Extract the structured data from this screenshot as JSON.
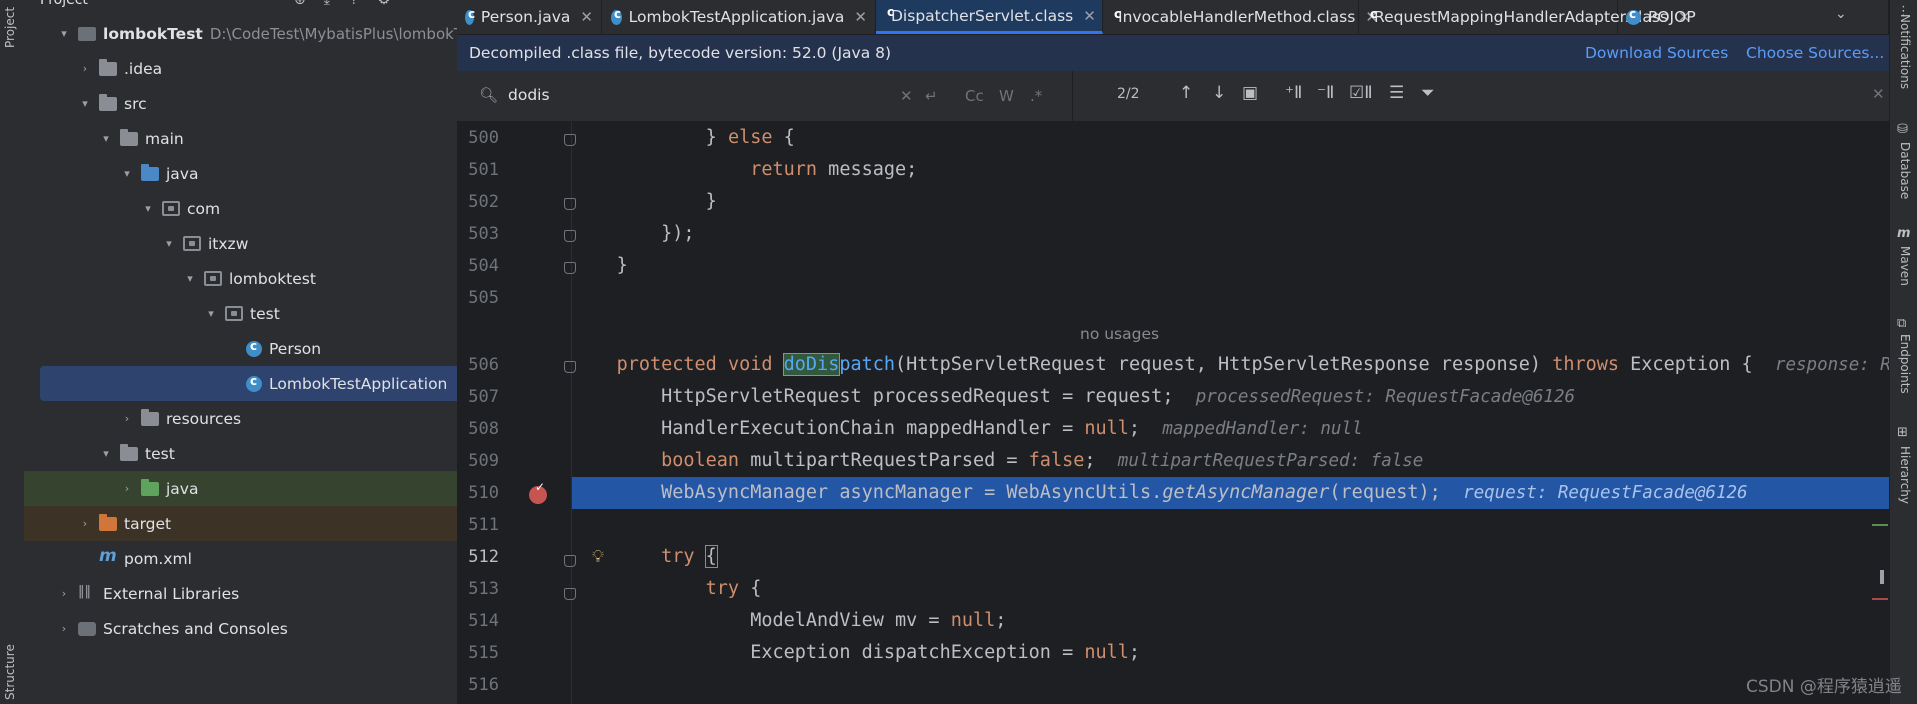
{
  "left_toolbar": {
    "project_label": "Project",
    "structure_label": "Structure"
  },
  "project_panel": {
    "title": "Project",
    "tree": [
      {
        "label": "lombokTest",
        "path": "D:\\CodeTest\\MybatisPlus\\lombokTest",
        "icon": "module-folder-icon",
        "expanded": true
      },
      {
        "label": ".idea",
        "icon": "folder-icon"
      },
      {
        "label": "src",
        "icon": "folder-icon"
      },
      {
        "label": "main",
        "icon": "folder-icon"
      },
      {
        "label": "java",
        "icon": "source-folder-icon"
      },
      {
        "label": "com",
        "icon": "package-icon"
      },
      {
        "label": "itxzw",
        "icon": "package-icon"
      },
      {
        "label": "lomboktest",
        "icon": "package-icon"
      },
      {
        "label": "test",
        "icon": "package-icon"
      },
      {
        "label": "Person",
        "icon": "class-icon"
      },
      {
        "label": "LombokTestApplication",
        "icon": "spring-class-icon"
      },
      {
        "label": "resources",
        "icon": "resources-folder-icon"
      },
      {
        "label": "test",
        "icon": "folder-icon"
      },
      {
        "label": "java",
        "icon": "test-source-folder-icon"
      },
      {
        "label": "target",
        "icon": "excluded-folder-icon"
      },
      {
        "label": "pom.xml",
        "icon": "maven-icon"
      },
      {
        "label": "External Libraries",
        "icon": "library-icon"
      },
      {
        "label": "Scratches and Consoles",
        "icon": "scratch-icon"
      }
    ]
  },
  "tabs": [
    {
      "label": "Person.java"
    },
    {
      "label": "LombokTestApplication.java"
    },
    {
      "label": "DispatcherServlet.class",
      "active": true
    },
    {
      "label": "InvocableHandlerMethod.class"
    },
    {
      "label": "RequestMappingHandlerAdapter.class"
    },
    {
      "label": "POJOP"
    }
  ],
  "banner": {
    "text": "Decompiled .class file, bytecode version: 52.0 (Java 8)",
    "download": "Download Sources",
    "choose": "Choose Sources..."
  },
  "search": {
    "value": "dodis",
    "count": "2/2",
    "case_label": "Cc",
    "word_label": "W",
    "regex_label": ".*"
  },
  "editor": {
    "no_usages": "no usages",
    "line_numbers": [
      "500",
      "501",
      "502",
      "503",
      "504",
      "505",
      "506",
      "507",
      "508",
      "509",
      "510",
      "511",
      "512",
      "513",
      "514",
      "515",
      "516"
    ],
    "lines": {
      "l500a": "} ",
      "l500b": "else",
      "l500c": " {",
      "l501a": "return",
      "l501b": " message;",
      "l502": "}",
      "l503": "});",
      "l504": "}",
      "l506kw1": "protected void ",
      "l506fn": "doDis",
      "l506fn2": "patch",
      "l506rest": "(HttpServletRequest request, HttpServletResponse response) ",
      "l506kw2": "throws",
      "l506end": " Exception {",
      "l506hint": "response: R",
      "l507": "HttpServletRequest processedRequest = request;",
      "l507hint": "processedRequest: RequestFacade@6126",
      "l508a": "HandlerExecutionChain mappedHandler = ",
      "l508kw": "null",
      "l508b": ";",
      "l508hint": "mappedHandler: null",
      "l509kw": "boolean",
      "l509a": " multipartRequestParsed = ",
      "l509kw2": "false",
      "l509b": ";",
      "l509hint": "multipartRequestParsed: false",
      "l510a": "WebAsyncManager asyncManager = WebAsyncUtils.",
      "l510fn": "getAsyncManager",
      "l510b": "(request);",
      "l510hint": "request: RequestFacade@6126",
      "l512kw": "try",
      "l512b": "{",
      "l513kw": "try",
      "l513b": " {",
      "l514a": "ModelAndView mv = ",
      "l514kw": "null",
      "l514b": ";",
      "l515a": "Exception dispatchException = ",
      "l515kw": "null",
      "l515b": ";"
    }
  },
  "right_bar": [
    "Notifications",
    "Database",
    "Maven",
    "Endpoints",
    "Hierarchy"
  ],
  "watermark": "CSDN @程序猿逍遥"
}
